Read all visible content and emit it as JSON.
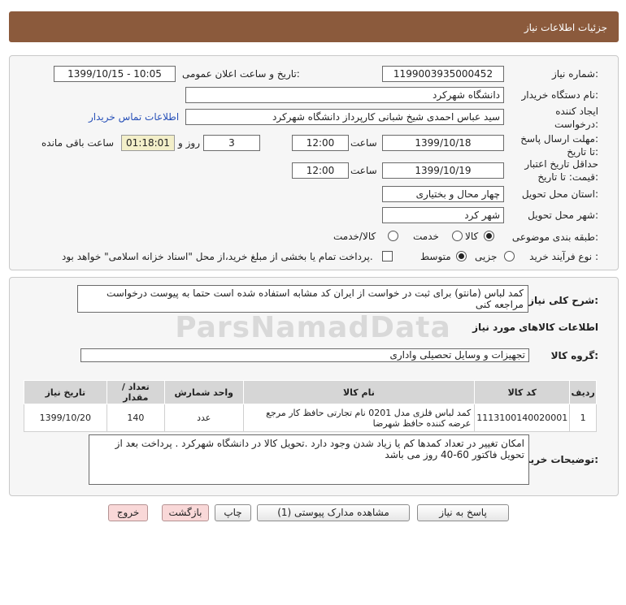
{
  "header": {
    "title": "جزئیات اطلاعات نیاز"
  },
  "fields": {
    "need_number_label": "شماره نیاز:",
    "need_number": "1199003935000452",
    "announce_label": "تاریخ و ساعت اعلان عمومی:",
    "announce_value": "1399/10/15 - 10:05",
    "buyer_org_label": "نام دستگاه خریدار:",
    "buyer_org": "دانشگاه شهرکرد",
    "creator_label_1": "ایجاد کننده",
    "creator_label_2": "درخواست:",
    "creator": "سید عباس احمدی شیخ شبانی کارپرداز دانشگاه شهرکرد",
    "contact_link": "اطلاعات تماس خریدار",
    "deadline_label_1": "مهلت ارسال پاسخ:",
    "deadline_label_2": "تا تاریخ:",
    "deadline_date": "1399/10/18",
    "time_label": "ساعت",
    "deadline_time": "12:00",
    "days_value": "3",
    "days_label": "روز و",
    "remaining_time": "01:18:01",
    "remaining_label": "ساعت باقی مانده",
    "validity_label_1": "حداقل تاریخ اعتبار",
    "validity_label_2": "قیمت: تا تاریخ:",
    "validity_date": "1399/10/19",
    "validity_time": "12:00",
    "province_label": "استان محل تحویل:",
    "province": "چهار محال و بختیاری",
    "city_label": "شهر محل تحویل:",
    "city": "شهر کرد",
    "category_label": "طبقه بندی موضوعی:",
    "category_options": [
      "کالا",
      "خدمت",
      "کالا/خدمت"
    ],
    "process_label": "نوع فرآیند خرید :",
    "process_options": [
      "جزیی",
      "متوسط"
    ],
    "payment_note": "پرداخت تمام یا بخشی از مبلغ خرید،از محل \"اسناد خزانه اسلامی\" خواهد بود."
  },
  "description": {
    "label": "شرح کلی نیاز:",
    "text": "کمد لباس (مانتو) برای ثبت در خواست از ایران کد مشابه استفاده شده است حتما به پیوست درخواست مراجعه کنی"
  },
  "goods_section_title": "اطلاعات کالاهای مورد نیاز",
  "goods_group": {
    "label": "گروه کالا:",
    "value": "تجهیزات و وسایل تحصیلی واداری"
  },
  "table": {
    "headers": [
      "ردیف",
      "کد کالا",
      "نام کالا",
      "واحد شمارش",
      "تعداد / مقدار",
      "تاریخ نیاز"
    ],
    "rows": [
      {
        "row": "1",
        "code": "1113100140020001",
        "name": "کمد لباس فلزی مدل 0201 نام تجارتی حافظ کار مرجع عرضه کننده حافظ شهرضا",
        "unit": "عدد",
        "qty": "140",
        "date": "1399/10/20"
      }
    ]
  },
  "buyer_notes": {
    "label": "توضیحات خریدار:",
    "text": "امکان تغییر در تعداد کمدها کم یا زیاد شدن وجود دارد .تحویل کالا در دانشگاه شهرکرد . پرداخت بعد از تحویل فاکتور 60-40 روز می باشد"
  },
  "buttons": {
    "reply": "پاسخ به نیاز",
    "attachments": "مشاهده مدارک پیوستی (1)",
    "print": "چاپ",
    "back": "بازگشت",
    "exit": "خروج"
  },
  "watermark": "ParsNamadData",
  "colors": {
    "header_bg": "#8b5a3c",
    "link": "#2750b8",
    "remaining_bg": "#f3efc9"
  }
}
